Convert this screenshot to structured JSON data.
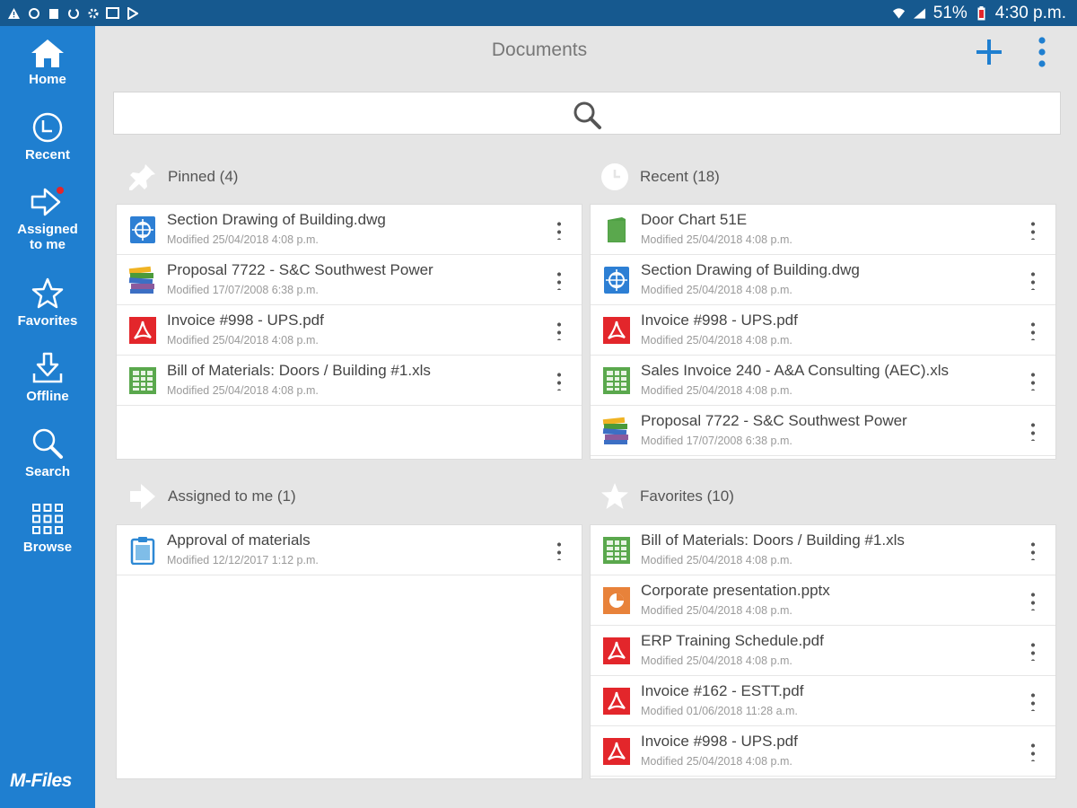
{
  "status_bar": {
    "battery": "51%",
    "time": "4:30 p.m."
  },
  "nav": {
    "items": [
      {
        "label": "Home",
        "icon": "home-icon"
      },
      {
        "label": "Recent",
        "icon": "recent-clock-icon"
      },
      {
        "label": "Assigned to me",
        "icon": "assigned-arrow-icon"
      },
      {
        "label": "Favorites",
        "icon": "star-icon"
      },
      {
        "label": "Offline",
        "icon": "download-icon"
      },
      {
        "label": "Search",
        "icon": "search-icon"
      },
      {
        "label": "Browse",
        "icon": "grid-icon"
      }
    ],
    "brand": "M-Files"
  },
  "header": {
    "title": "Documents"
  },
  "colors": {
    "sidebar": "#1f7fd0",
    "status_bar": "#16598f",
    "accent": "#1f7fd0",
    "pdf": "#e3262b",
    "xls": "#5aa84d",
    "pptx": "#e8823a"
  },
  "pinned": {
    "title": "Pinned (4)",
    "items": [
      {
        "name": "Section Drawing of Building.dwg",
        "meta": "Modified 25/04/2018 4:08 p.m.",
        "type": "dwg"
      },
      {
        "name": "Proposal 7722 - S&C Southwest Power",
        "meta": "Modified 17/07/2008 6:38 p.m.",
        "type": "books"
      },
      {
        "name": "Invoice #998 - UPS.pdf",
        "meta": "Modified 25/04/2018 4:08 p.m.",
        "type": "pdf"
      },
      {
        "name": "Bill of Materials: Doors / Building #1.xls",
        "meta": "Modified 25/04/2018 4:08 p.m.",
        "type": "xls"
      }
    ]
  },
  "recent": {
    "title": "Recent (18)",
    "items": [
      {
        "name": "Door Chart 51E",
        "meta": "Modified 25/04/2018 4:08 p.m.",
        "type": "door"
      },
      {
        "name": "Section Drawing of Building.dwg",
        "meta": "Modified 25/04/2018 4:08 p.m.",
        "type": "dwg"
      },
      {
        "name": "Invoice #998 - UPS.pdf",
        "meta": "Modified 25/04/2018 4:08 p.m.",
        "type": "pdf"
      },
      {
        "name": "Sales Invoice 240 - A&A Consulting (AEC).xls",
        "meta": "Modified 25/04/2018 4:08 p.m.",
        "type": "xls"
      },
      {
        "name": "Proposal 7722 - S&C Southwest Power",
        "meta": "Modified 17/07/2008 6:38 p.m.",
        "type": "books"
      }
    ]
  },
  "assigned": {
    "title": "Assigned to me (1)",
    "items": [
      {
        "name": "Approval of materials",
        "meta": "Modified 12/12/2017 1:12 p.m.",
        "type": "clipboard"
      }
    ]
  },
  "favorites": {
    "title": "Favorites (10)",
    "items": [
      {
        "name": "Bill of Materials: Doors / Building #1.xls",
        "meta": "Modified 25/04/2018 4:08 p.m.",
        "type": "xls"
      },
      {
        "name": "Corporate presentation.pptx",
        "meta": "Modified 25/04/2018 4:08 p.m.",
        "type": "pptx"
      },
      {
        "name": "ERP Training Schedule.pdf",
        "meta": "Modified 25/04/2018 4:08 p.m.",
        "type": "pdf"
      },
      {
        "name": "Invoice #162 - ESTT.pdf",
        "meta": "Modified 01/06/2018 11:28 a.m.",
        "type": "pdf"
      },
      {
        "name": "Invoice #998 - UPS.pdf",
        "meta": "Modified 25/04/2018 4:08 p.m.",
        "type": "pdf"
      }
    ]
  }
}
